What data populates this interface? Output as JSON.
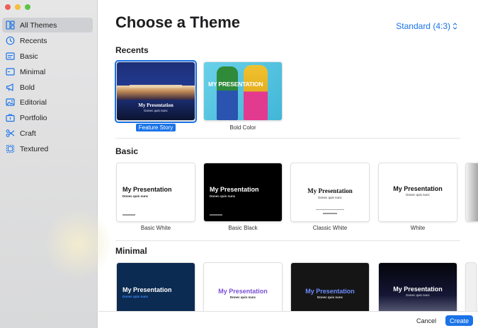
{
  "sidebar": {
    "items": [
      {
        "label": "All Themes",
        "icon": "all-themes-icon",
        "selected": true
      },
      {
        "label": "Recents",
        "icon": "clock-icon",
        "selected": false
      },
      {
        "label": "Basic",
        "icon": "basic-icon",
        "selected": false
      },
      {
        "label": "Minimal",
        "icon": "minimal-icon",
        "selected": false
      },
      {
        "label": "Bold",
        "icon": "megaphone-icon",
        "selected": false
      },
      {
        "label": "Editorial",
        "icon": "photo-icon",
        "selected": false
      },
      {
        "label": "Portfolio",
        "icon": "portfolio-icon",
        "selected": false
      },
      {
        "label": "Craft",
        "icon": "scissors-icon",
        "selected": false
      },
      {
        "label": "Textured",
        "icon": "textured-icon",
        "selected": false
      }
    ]
  },
  "header": {
    "title": "Choose a Theme",
    "aspect": "Standard (4:3)"
  },
  "sections": {
    "recents": "Recents",
    "basic": "Basic",
    "minimal": "Minimal"
  },
  "recents": [
    {
      "name": "Feature Story",
      "title": "My Presentation",
      "subtitle": "Donec quis nunc"
    },
    {
      "name": "Bold Color",
      "title": "MY PRESENTATION"
    }
  ],
  "basic": [
    {
      "name": "Basic White",
      "title": "My Presentation",
      "subtitle": "Donec quis nunc"
    },
    {
      "name": "Basic Black",
      "title": "My Presentation",
      "subtitle": "Donec quis nunc"
    },
    {
      "name": "Classic White",
      "title": "My Presentation",
      "subtitle": "Donec quis nunc"
    },
    {
      "name": "White",
      "title": "My Presentation",
      "subtitle": "Donec quis nunc"
    }
  ],
  "minimal": [
    {
      "title": "My Presentation",
      "subtitle": "Donec quis nunc"
    },
    {
      "title": "My Presentation",
      "subtitle": "Donec quis nunc"
    },
    {
      "title": "My Presentation",
      "subtitle": "Donec quis nunc"
    },
    {
      "title": "My Presentation",
      "subtitle": "Donec quis nunc"
    }
  ],
  "footer": {
    "cancel": "Cancel",
    "create": "Create"
  },
  "colors": {
    "accent": "#1a73e8",
    "sidebar_selected": "#cfd0d3"
  }
}
